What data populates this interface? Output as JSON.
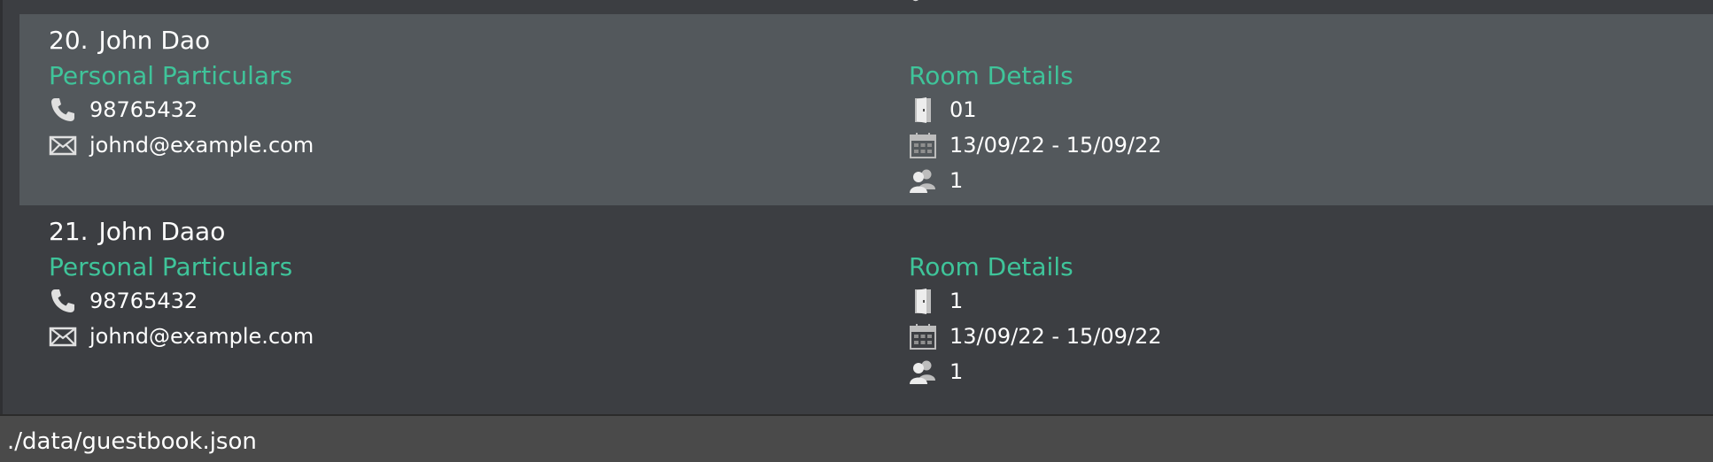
{
  "guests": [
    {
      "index": "20.",
      "name": "John Dao",
      "personal_heading": "Personal Particulars",
      "room_heading": "Room Details",
      "phone": "98765432",
      "email": "johnd@example.com",
      "room": "01",
      "dates": "13/09/22 - 15/09/22",
      "guests_count": "1"
    },
    {
      "index": "21.",
      "name": "John Daao",
      "personal_heading": "Personal Particulars",
      "room_heading": "Room Details",
      "phone": "98765432",
      "email": "johnd@example.com",
      "room": "1",
      "dates": "13/09/22 - 15/09/22",
      "guests_count": "1"
    }
  ],
  "status_bar": {
    "file_path": "./data/guestbook.json"
  },
  "icons": {
    "phone": "phone-icon",
    "email": "envelope-icon",
    "room": "door-icon",
    "dates": "calendar-icon",
    "guests": "people-icon"
  },
  "colors": {
    "heading_green": "#3fc49a",
    "card_selected": "#53585c",
    "card_default": "#3c3e42",
    "status_bar": "#4a4a4a"
  }
}
